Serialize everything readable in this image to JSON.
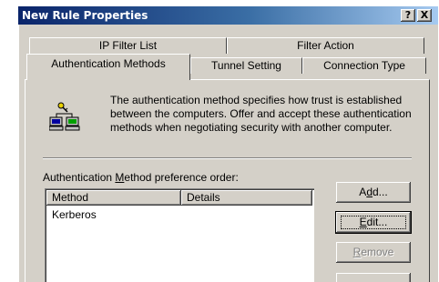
{
  "window": {
    "title": "New Rule Properties",
    "help_glyph": "?",
    "close_glyph": "X"
  },
  "tabs": {
    "back_row": [
      "IP Filter List",
      "Filter Action"
    ],
    "front_row": [
      "Authentication Methods",
      "Tunnel Setting",
      "Connection Type"
    ],
    "active": "Authentication Methods"
  },
  "panel": {
    "description": "The authentication method specifies how trust is established between the computers. Offer and accept these authentication methods when negotiating security with another computer.",
    "icon": "network-computers-key-icon",
    "list_label": {
      "before": "Authentication ",
      "mnemonic": "M",
      "after": "ethod preference order:"
    },
    "columns": [
      "Method",
      "Details"
    ],
    "rows": [
      {
        "method": "Kerberos",
        "details": ""
      }
    ]
  },
  "buttons": {
    "add": {
      "before": "A",
      "mnemonic": "d",
      "after": "d..."
    },
    "edit": {
      "before": "",
      "mnemonic": "E",
      "after": "dit..."
    },
    "remove": {
      "before": "",
      "mnemonic": "R",
      "after": "emove"
    }
  },
  "colors": {
    "titlebar_start": "#0a246a",
    "titlebar_end": "#a6caf0",
    "face": "#d4d0c8"
  }
}
